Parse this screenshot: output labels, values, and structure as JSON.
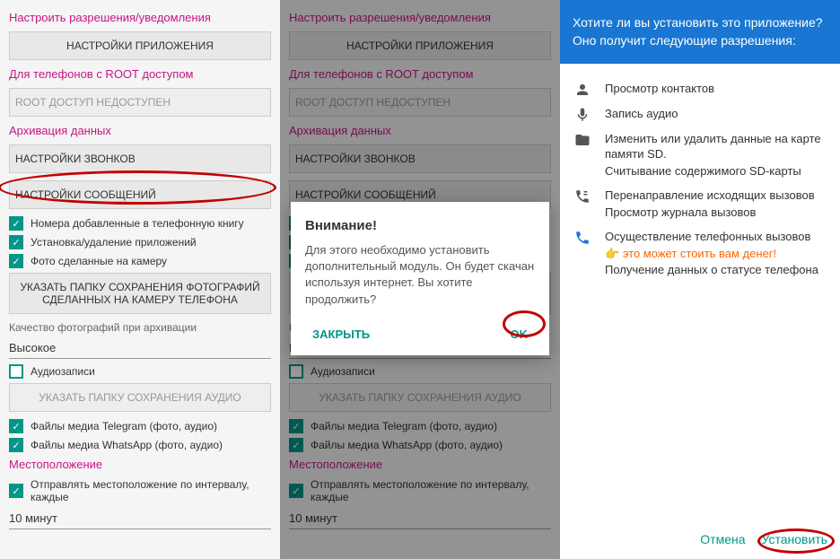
{
  "p1": {
    "header1": "Настроить разрешения/уведомления",
    "btn_app": "НАСТРОЙКИ ПРИЛОЖЕНИЯ",
    "header2": "Для телефонов с ROOT доступом",
    "root_status": "ROOT ДОСТУП НЕДОСТУПЕН",
    "header3": "Архивация данных",
    "btn_calls": "НАСТРОЙКИ ЗВОНКОВ",
    "btn_msgs": "НАСТРОЙКИ СООБЩЕНИЙ",
    "cb1": "Номера добавленные в телефонную книгу",
    "cb2": "Установка/удаление приложений",
    "cb3": "Фото сделанные на камеру",
    "btn_photo": "УКАЗАТЬ ПАПКУ СОХРАНЕНИЯ ФОТОГРАФИЙ СДЕЛАННЫХ НА КАМЕРУ ТЕЛЕФОНА",
    "label_q": "Качество фотографий при архивации",
    "quality": "Высокое",
    "cb4": "Аудиозаписи",
    "btn_audio": "УКАЗАТЬ ПАПКУ СОХРАНЕНИЯ АУДИО",
    "cb5": "Файлы медиа Telegram (фото, аудио)",
    "cb6": "Файлы медиа WhatsApp (фото, аудио)",
    "header4": "Местоположение",
    "cb7": "Отправлять местоположение по интервалу, каждые",
    "interval": "10 минут"
  },
  "dialog": {
    "title": "Внимание!",
    "body": "Для этого необходимо установить дополнительный модуль. Он будет скачан используя интернет. Вы хотите продолжить?",
    "close": "ЗАКРЫТЬ",
    "ok": "OK"
  },
  "p3": {
    "question": "Хотите ли вы установить это приложение? Оно получит следующие разрешения:",
    "perms": {
      "contacts": "Просмотр контактов",
      "audio": "Запись аудио",
      "sd1": "Изменить или удалить данные на карте памяти SD.",
      "sd2": "Считывание содержимого SD-карты",
      "calls1": "Перенаправление исходящих вызовов",
      "calls2": "Просмотр журнала вызовов",
      "phone1": "Осуществление телефонных вызовов",
      "phone_warn": "это может стоить вам денег!",
      "phone2": "Получение данных о статусе телефона"
    },
    "cancel": "Отмена",
    "install": "Установить"
  }
}
